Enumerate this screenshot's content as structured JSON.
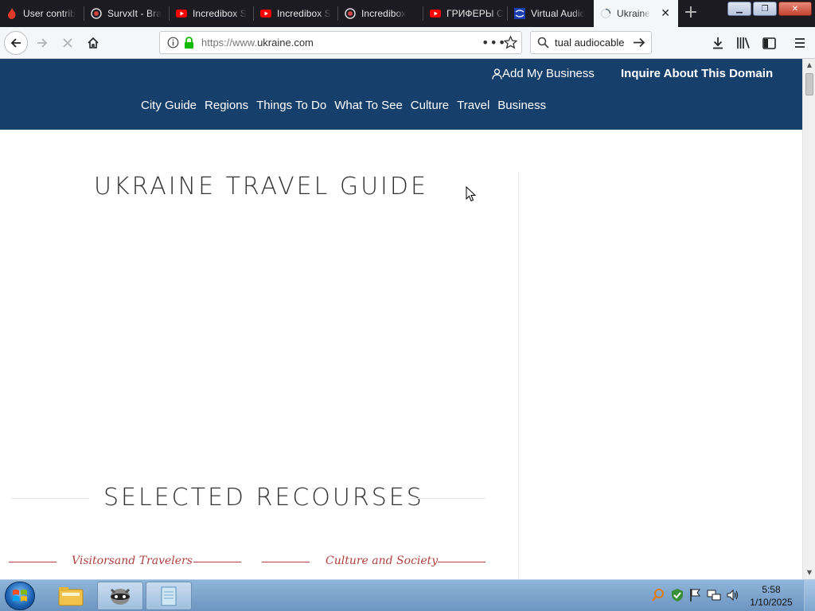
{
  "browser": {
    "tabs": [
      {
        "title": "User contrib",
        "icon": "flame-icon",
        "active": false
      },
      {
        "title": "SurvxIt - Bra",
        "icon": "shield-icon",
        "active": false
      },
      {
        "title": "Incredibox S",
        "icon": "youtube-icon",
        "active": false
      },
      {
        "title": "Incredibox S",
        "icon": "youtube-icon",
        "active": false
      },
      {
        "title": "Incredibox",
        "icon": "shield-icon",
        "active": false
      },
      {
        "title": "ГРИФЕРЫ С",
        "icon": "youtube-icon",
        "active": false
      },
      {
        "title": "Virtual Audio",
        "icon": "vac-icon",
        "active": false
      },
      {
        "title": "Ukraine",
        "icon": "loading-icon",
        "active": true
      }
    ],
    "url_scheme": "https://www.",
    "url_host": "ukraine.com",
    "search_value": "tual audiocable"
  },
  "site": {
    "add_business": "Add My Business",
    "inquire": "Inquire About This Domain",
    "nav": [
      "City Guide",
      "Regions",
      "Things To Do",
      "What To See",
      "Culture",
      "Travel",
      "Business"
    ],
    "page_title": "UKRAINE TRAVEL GUIDE",
    "section_title": "SELECTED RECOURSES",
    "categories": [
      "Visitorsand Travelers",
      "Culture and Society"
    ]
  },
  "taskbar": {
    "apps": [
      {
        "name": "explorer-icon",
        "open": false
      },
      {
        "name": "raccoon-app-icon",
        "open": true
      },
      {
        "name": "notepad-icon",
        "open": true
      }
    ],
    "time": "5:58",
    "date": "1/10/2025"
  },
  "colors": {
    "header_bg": "#163f6b",
    "accent_red": "#b0413e",
    "tabstrip_bg": "#1c1b22"
  }
}
